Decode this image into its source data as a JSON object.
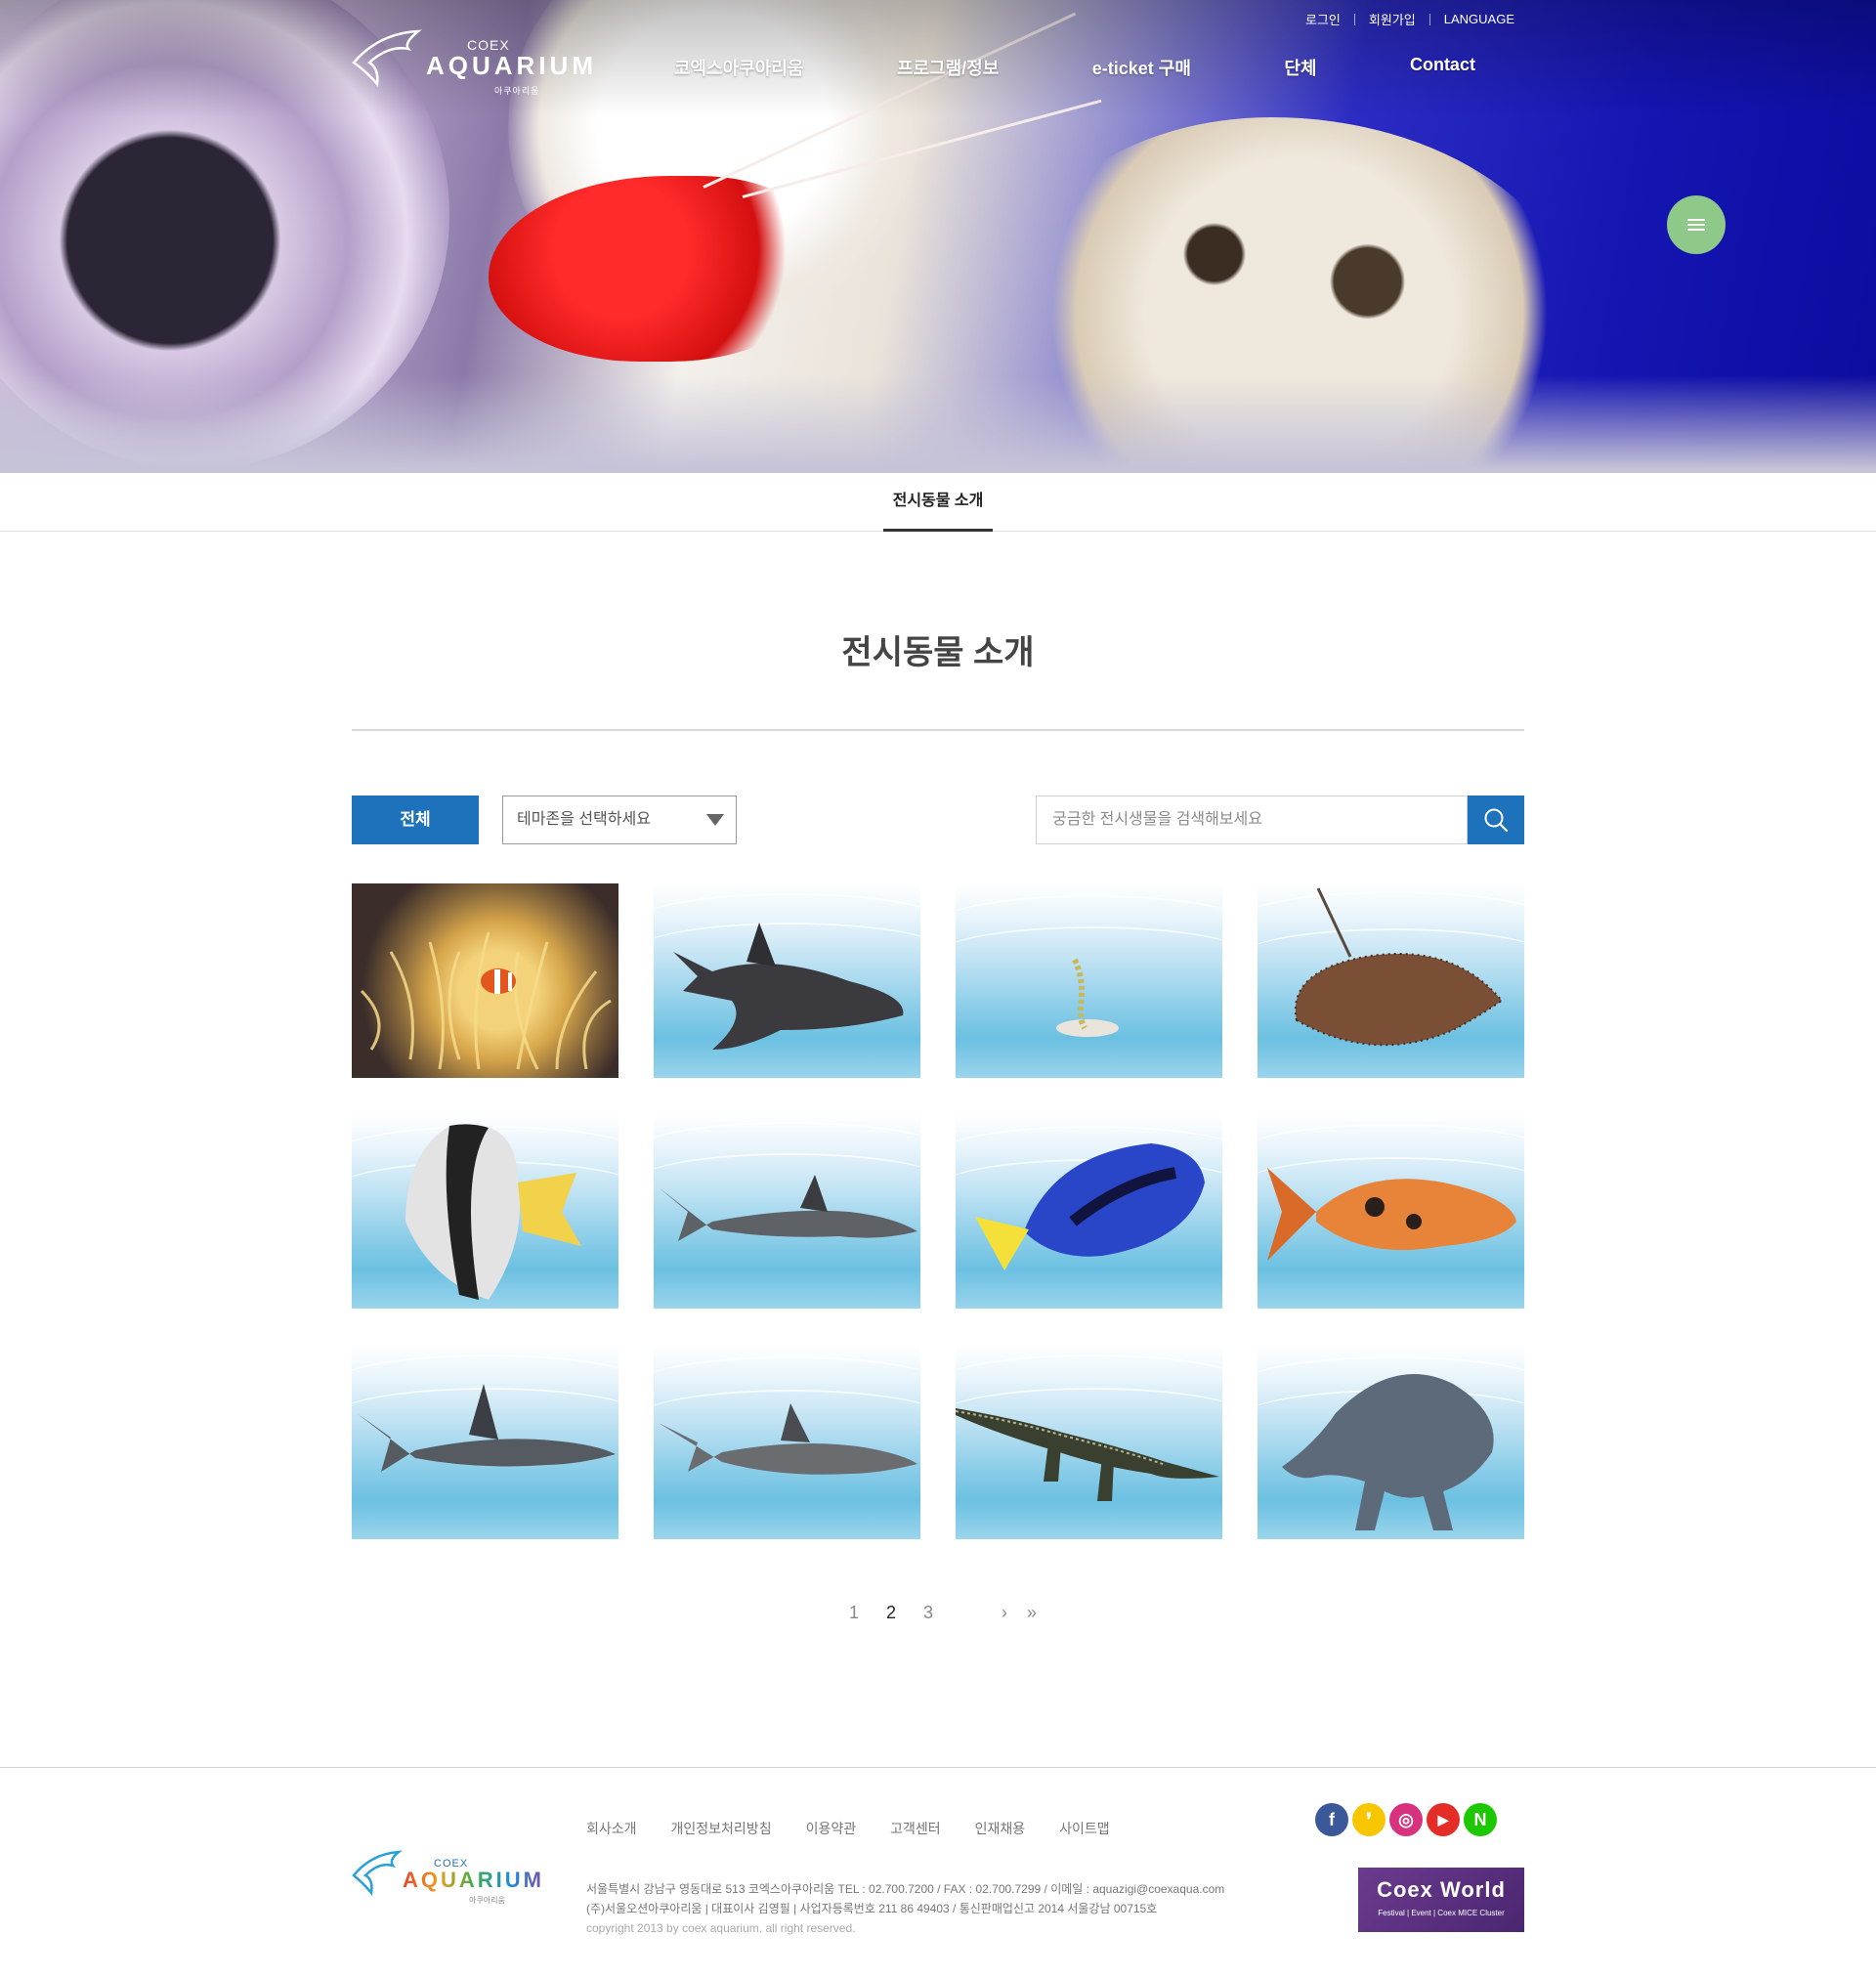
{
  "header": {
    "logo_small": "COEX",
    "logo_big": "AQUARIUM",
    "logo_kor": "아쿠아리움",
    "top_links": [
      "로그인",
      "회원가입",
      "LANGUAGE"
    ],
    "nav": [
      "코엑스아쿠아리움",
      "프로그램/정보",
      "e-ticket 구매",
      "단체",
      "Contact"
    ],
    "menu_icon": "hamburger-icon",
    "menu_color": "#8ec98a"
  },
  "subnav": {
    "active_tab": "전시동물 소개"
  },
  "page": {
    "title": "전시동물 소개"
  },
  "filter": {
    "all_button": "전체",
    "theme_select_value": "테마존을 선택하세요",
    "search_placeholder": "궁금한 전시생물을 검색해보세요",
    "accent_color": "#1e72bc"
  },
  "animals": [
    "clownfish-anemone",
    "shovelnose-ray",
    "garden-eel",
    "stingray",
    "batfish",
    "blacktip-reef-shark",
    "blue-tang",
    "koi",
    "sandbar-shark",
    "sand-tiger-shark",
    "crocodile",
    "manatee"
  ],
  "pagination": {
    "pages": [
      "1",
      "2",
      "3"
    ],
    "current": "2",
    "next": "›",
    "last": "»"
  },
  "footer": {
    "links": [
      "회사소개",
      "개인정보처리방침",
      "이용약관",
      "고객센터",
      "인재채용",
      "사이트맵"
    ],
    "address_line1": "서울특별시 강남구 영동대로 513 코엑스아쿠아리움 TEL : 02.700.7200 / FAX : 02.700.7299 / 이메일 : aquazigi@coexaqua.com",
    "address_line2": "(주)서울오션아쿠아리움 | 대표이사 김영필 | 사업자등록번호 211 86 49403 / 통신판매업신고 2014 서울강남 00715호",
    "copyright": "copyright 2013 by coex aquarium. all right reserved.",
    "sns": [
      {
        "icon": "facebook-icon",
        "glyph": "f",
        "color": "#3b5998"
      },
      {
        "icon": "kakaostory-icon",
        "glyph": "❜",
        "color": "#f7c600"
      },
      {
        "icon": "instagram-icon",
        "glyph": "◎",
        "color": "#d6327e"
      },
      {
        "icon": "youtube-icon",
        "glyph": "▶",
        "color": "#e52d27"
      },
      {
        "icon": "naver-icon",
        "glyph": "N",
        "color": "#1ec800"
      }
    ],
    "coexworld_title": "Coex World",
    "coexworld_sub": "Festival | Event | Coex MICE Cluster"
  }
}
